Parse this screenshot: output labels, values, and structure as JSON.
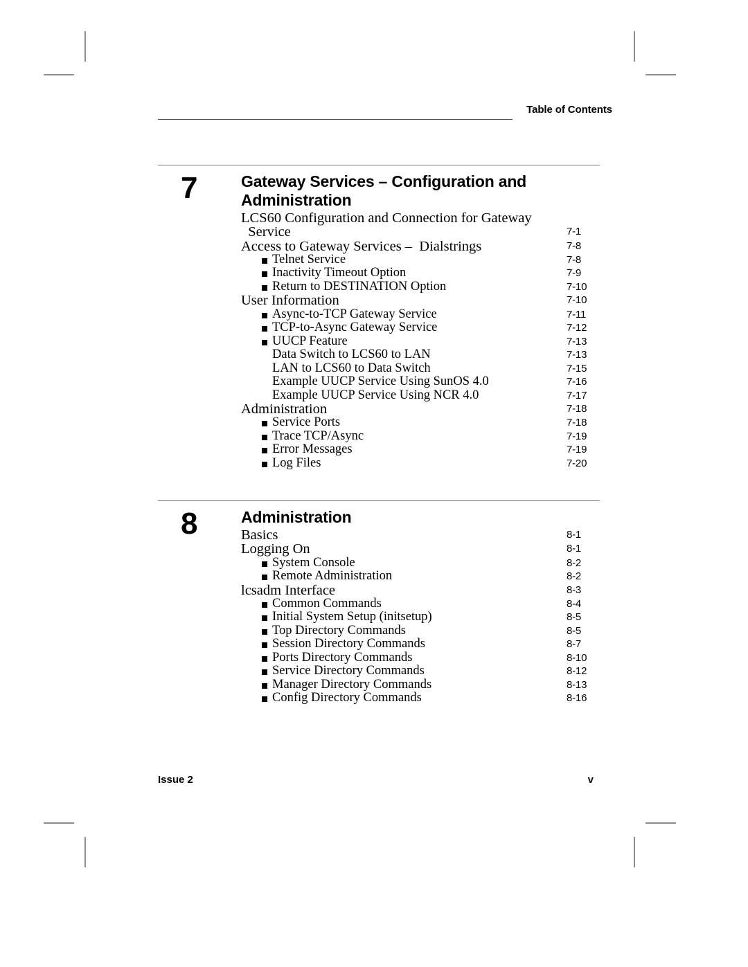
{
  "header": {
    "title": "Table of Contents"
  },
  "chapters": [
    {
      "number": "7",
      "title": "Gateway Services –  Configuration and Administration",
      "entries": [
        {
          "level": 1,
          "label": "LCS60 Configuration and Connection for Gateway\n  Service",
          "page": "7-1",
          "wrapped": true
        },
        {
          "level": 1,
          "label": "Access to Gateway Services –  Dialstrings",
          "page": "7-8"
        },
        {
          "level": 2,
          "label": "Telnet Service",
          "page": "7-8"
        },
        {
          "level": 2,
          "label": "Inactivity Timeout Option",
          "page": "7-9"
        },
        {
          "level": 2,
          "label": "Return to DESTINATION Option",
          "page": "7-10"
        },
        {
          "level": 1,
          "label": "User Information",
          "page": "7-10"
        },
        {
          "level": 2,
          "label": "Async-to-TCP Gateway Service",
          "page": "7-11"
        },
        {
          "level": 2,
          "label": "TCP-to-Async Gateway Service",
          "page": "7-12"
        },
        {
          "level": 2,
          "label": "UUCP Feature",
          "page": "7-13"
        },
        {
          "level": 3,
          "label": "Data Switch to LCS60 to LAN",
          "page": "7-13"
        },
        {
          "level": 3,
          "label": "LAN to LCS60 to Data Switch",
          "page": "7-15"
        },
        {
          "level": 3,
          "label": "Example UUCP Service Using SunOS 4.0",
          "page": "7-16"
        },
        {
          "level": 3,
          "label": "Example UUCP Service Using NCR 4.0",
          "page": "7-17"
        },
        {
          "level": 1,
          "label": "Administration",
          "page": "7-18"
        },
        {
          "level": 2,
          "label": "Service Ports",
          "page": "7-18"
        },
        {
          "level": 2,
          "label": "Trace TCP/Async",
          "page": "7-19"
        },
        {
          "level": 2,
          "label": "Error Messages",
          "page": "7-19"
        },
        {
          "level": 2,
          "label": "Log Files",
          "page": "7-20"
        }
      ]
    },
    {
      "number": "8",
      "title": "Administration",
      "entries": [
        {
          "level": 1,
          "label": "Basics",
          "page": "8-1"
        },
        {
          "level": 1,
          "label": "Logging On",
          "page": "8-1"
        },
        {
          "level": 2,
          "label": "System Console",
          "page": "8-2"
        },
        {
          "level": 2,
          "label": "Remote Administration",
          "page": "8-2"
        },
        {
          "level": 1,
          "label": "lcsadm Interface",
          "page": "8-3"
        },
        {
          "level": 2,
          "label": "Common Commands",
          "page": "8-4"
        },
        {
          "level": 2,
          "label": "Initial System Setup (initsetup)",
          "page": "8-5"
        },
        {
          "level": 2,
          "label": "Top Directory Commands",
          "page": "8-5"
        },
        {
          "level": 2,
          "label": "Session Directory Commands",
          "page": "8-7"
        },
        {
          "level": 2,
          "label": "Ports Directory Commands",
          "page": "8-10"
        },
        {
          "level": 2,
          "label": "Service Directory Commands",
          "page": "8-12"
        },
        {
          "level": 2,
          "label": "Manager Directory Commands",
          "page": "8-13"
        },
        {
          "level": 2,
          "label": "Config Directory Commands",
          "page": "8-16"
        }
      ]
    }
  ],
  "footer": {
    "issue": "Issue 2",
    "folio": "v"
  },
  "colors": {
    "text": "#000000",
    "rule": "#6e6e6e",
    "crop_mark": "#8d8d8d"
  }
}
